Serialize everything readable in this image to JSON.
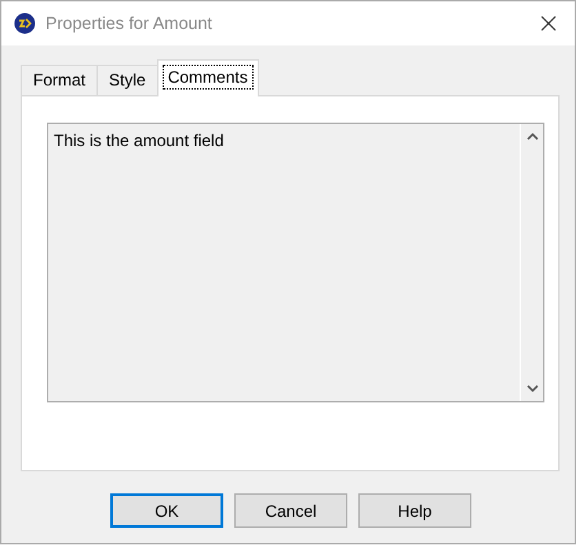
{
  "window": {
    "title": "Properties for Amount"
  },
  "tabs": [
    {
      "label": "Format",
      "selected": false
    },
    {
      "label": "Style",
      "selected": false
    },
    {
      "label": "Comments",
      "selected": true
    }
  ],
  "comments": {
    "value": "This is the amount field"
  },
  "buttons": [
    {
      "label": "OK",
      "default": true
    },
    {
      "label": "Cancel",
      "default": false
    },
    {
      "label": "Help",
      "default": false
    }
  ]
}
